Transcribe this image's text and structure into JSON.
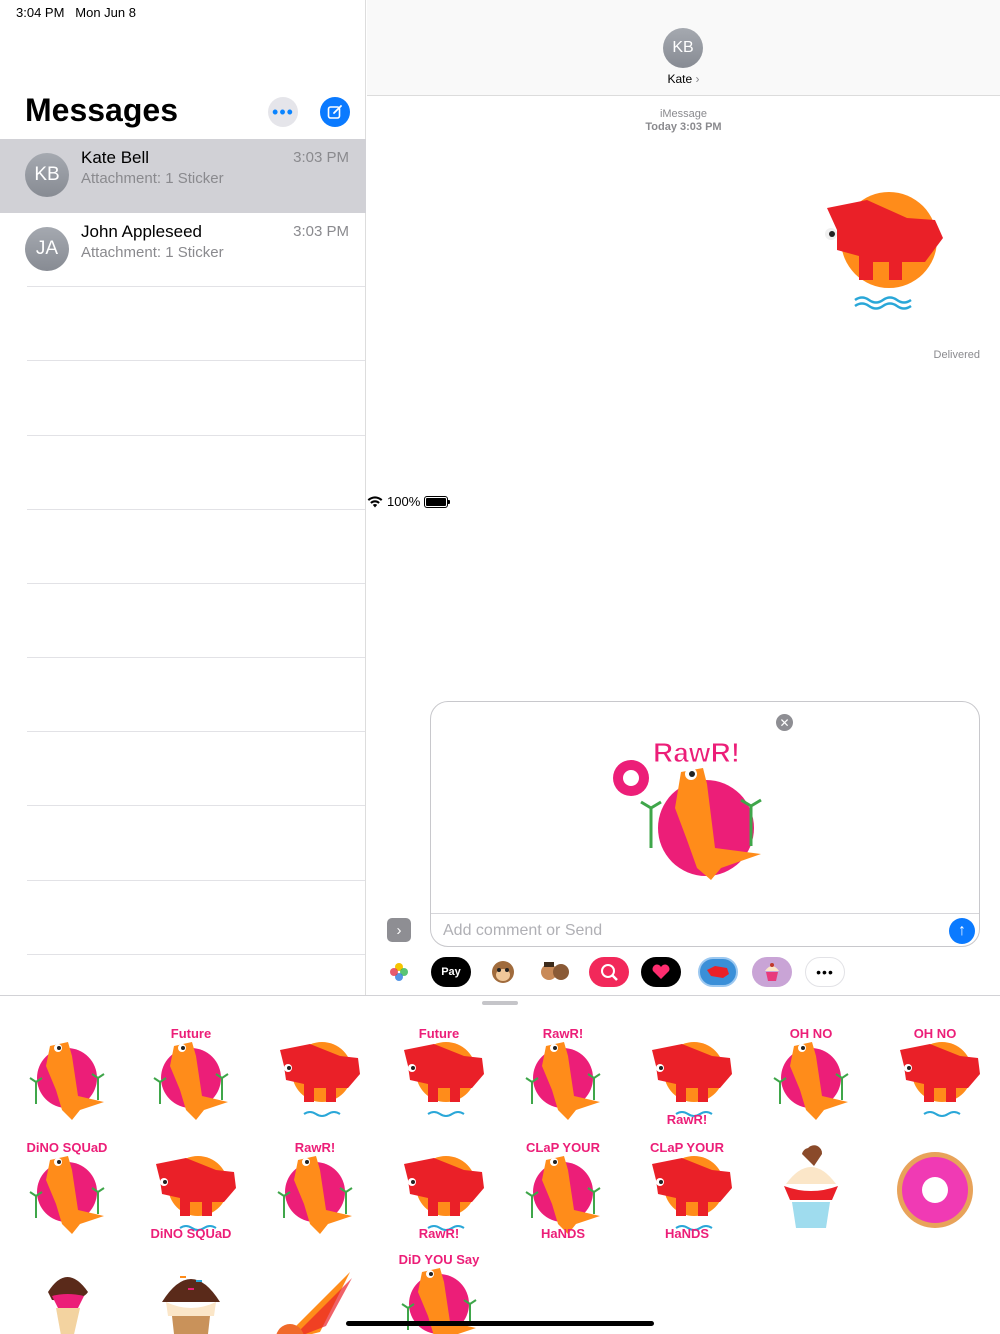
{
  "status_bar": {
    "time": "3:04 PM",
    "date": "Mon Jun 8",
    "battery": "100%"
  },
  "sidebar": {
    "title": "Messages",
    "conversations": [
      {
        "initials": "KB",
        "name": "Kate Bell",
        "preview": "Attachment: 1 Sticker",
        "time": "3:03 PM",
        "selected": true
      },
      {
        "initials": "JA",
        "name": "John Appleseed",
        "preview": "Attachment: 1 Sticker",
        "time": "3:03 PM",
        "selected": false
      }
    ]
  },
  "conversation": {
    "avatar_initials": "KB",
    "contact_name": "Kate",
    "service": "iMessage",
    "timestamp": "Today 3:03 PM",
    "status": "Delivered"
  },
  "compose": {
    "placeholder": "Add comment or Send",
    "sticker_caption": "RawR!"
  },
  "app_strip": [
    "photos-app",
    "apple-pay-app",
    "animoji-app",
    "memoji-app",
    "search-images-app",
    "digital-touch-app",
    "dino-stickers-app",
    "cupcake-stickers-app",
    "more-apps"
  ],
  "app_strip_labels": {
    "apple_pay": "Pay"
  },
  "stickers": {
    "captions": {
      "future": "Future",
      "rawr": "RawR!",
      "oh_no": "OH NO",
      "dino_squad": "DiNO SQUaD",
      "clap": "CLaP YOUR",
      "hands": "HaNDS",
      "did_you_say": "DiD YOU Say"
    }
  },
  "colors": {
    "accent": "#0a7aff",
    "orange": "#ff8c1a",
    "pink": "#ec1e78",
    "red": "#ea2028",
    "teal": "#2aa7d8"
  }
}
